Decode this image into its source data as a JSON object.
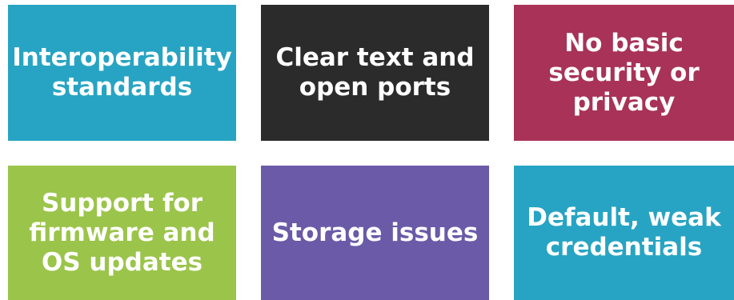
{
  "tiles": [
    {
      "text": "Interoperability\nstandards",
      "color": "#27a4c3"
    },
    {
      "text": "Clear text and\nopen ports",
      "color": "#2b2b2b"
    },
    {
      "text": "No basic\nsecurity or\nprivacy",
      "color": "#a83258"
    },
    {
      "text": "Support for\nfirmware and\nOS updates",
      "color": "#9bc44a"
    },
    {
      "text": "Storage issues",
      "color": "#6a5aa8"
    },
    {
      "text": "Default, weak\ncredentials",
      "color": "#27a4c3"
    }
  ]
}
